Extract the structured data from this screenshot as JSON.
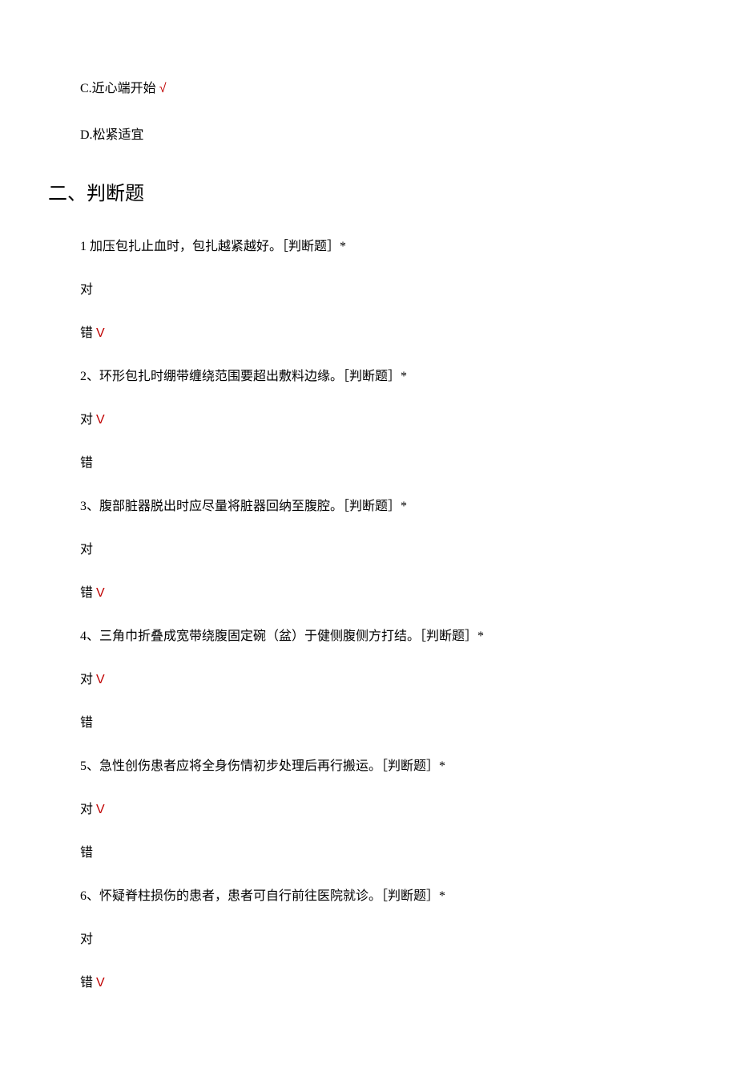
{
  "options": {
    "c": {
      "label": "C.近心端开始",
      "mark": "√"
    },
    "d": {
      "label": "D.松紧适宜"
    }
  },
  "section": {
    "heading": "二、判断题"
  },
  "questions": [
    {
      "text": "1 加压包扎止血时，包扎越紧越好。［判断题］*",
      "correct": {
        "label": "对",
        "mark": ""
      },
      "wrong": {
        "label": "错",
        "mark": "V"
      }
    },
    {
      "text": "2、环形包扎时绷带缠绕范围要超出敷料边缘。［判断题］*",
      "correct": {
        "label": "对",
        "mark": "V"
      },
      "wrong": {
        "label": "错",
        "mark": ""
      }
    },
    {
      "text": "3、腹部脏器脱出时应尽量将脏器回纳至腹腔。［判断题］*",
      "correct": {
        "label": "对",
        "mark": ""
      },
      "wrong": {
        "label": "错",
        "mark": "V"
      }
    },
    {
      "text": "4、三角巾折叠成宽带绕腹固定碗（盆）于健侧腹侧方打结。［判断题］*",
      "correct": {
        "label": "对",
        "mark": "V"
      },
      "wrong": {
        "label": "错",
        "mark": ""
      }
    },
    {
      "text": "5、急性创伤患者应将全身伤情初步处理后再行搬运。［判断题］*",
      "correct": {
        "label": "对",
        "mark": "V"
      },
      "wrong": {
        "label": "错",
        "mark": ""
      }
    },
    {
      "text": "6、怀疑脊柱损伤的患者，患者可自行前往医院就诊。［判断题］*",
      "correct": {
        "label": "对",
        "mark": ""
      },
      "wrong": {
        "label": "错",
        "mark": "V"
      }
    }
  ]
}
